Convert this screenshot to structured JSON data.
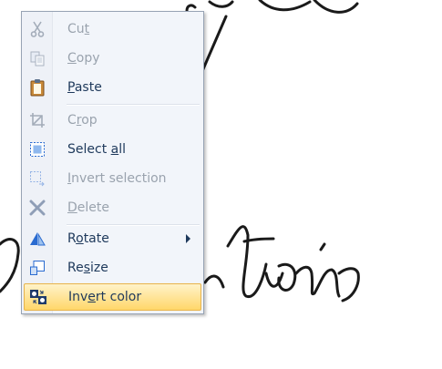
{
  "menu": {
    "items": [
      {
        "name": "cut",
        "pre": "Cu",
        "key": "t",
        "post": "",
        "icon": "scissors-icon",
        "enabled": false
      },
      {
        "name": "copy",
        "pre": "",
        "key": "C",
        "post": "opy",
        "icon": "copy-icon",
        "enabled": false
      },
      {
        "name": "paste",
        "pre": "",
        "key": "P",
        "post": "aste",
        "icon": "clipboard-icon",
        "enabled": true
      },
      {
        "name": "crop",
        "pre": "C",
        "key": "r",
        "post": "op",
        "icon": "crop-icon",
        "enabled": false
      },
      {
        "name": "select-all",
        "pre": "Select ",
        "key": "a",
        "post": "ll",
        "icon": "select-all-icon",
        "enabled": true
      },
      {
        "name": "invert-selection",
        "pre": "",
        "key": "I",
        "post": "nvert selection",
        "icon": "invert-selection-icon",
        "enabled": false
      },
      {
        "name": "delete",
        "pre": "",
        "key": "D",
        "post": "elete",
        "icon": "delete-icon",
        "enabled": false
      },
      {
        "name": "rotate",
        "pre": "R",
        "key": "o",
        "post": "tate",
        "icon": "rotate-icon",
        "enabled": true,
        "submenu": true
      },
      {
        "name": "resize",
        "pre": "Re",
        "key": "s",
        "post": "ize",
        "icon": "resize-icon",
        "enabled": true
      },
      {
        "name": "invert-color",
        "pre": "Inv",
        "key": "e",
        "post": "rt color",
        "icon": "invert-color-icon",
        "enabled": true,
        "highlighted": true
      }
    ]
  }
}
